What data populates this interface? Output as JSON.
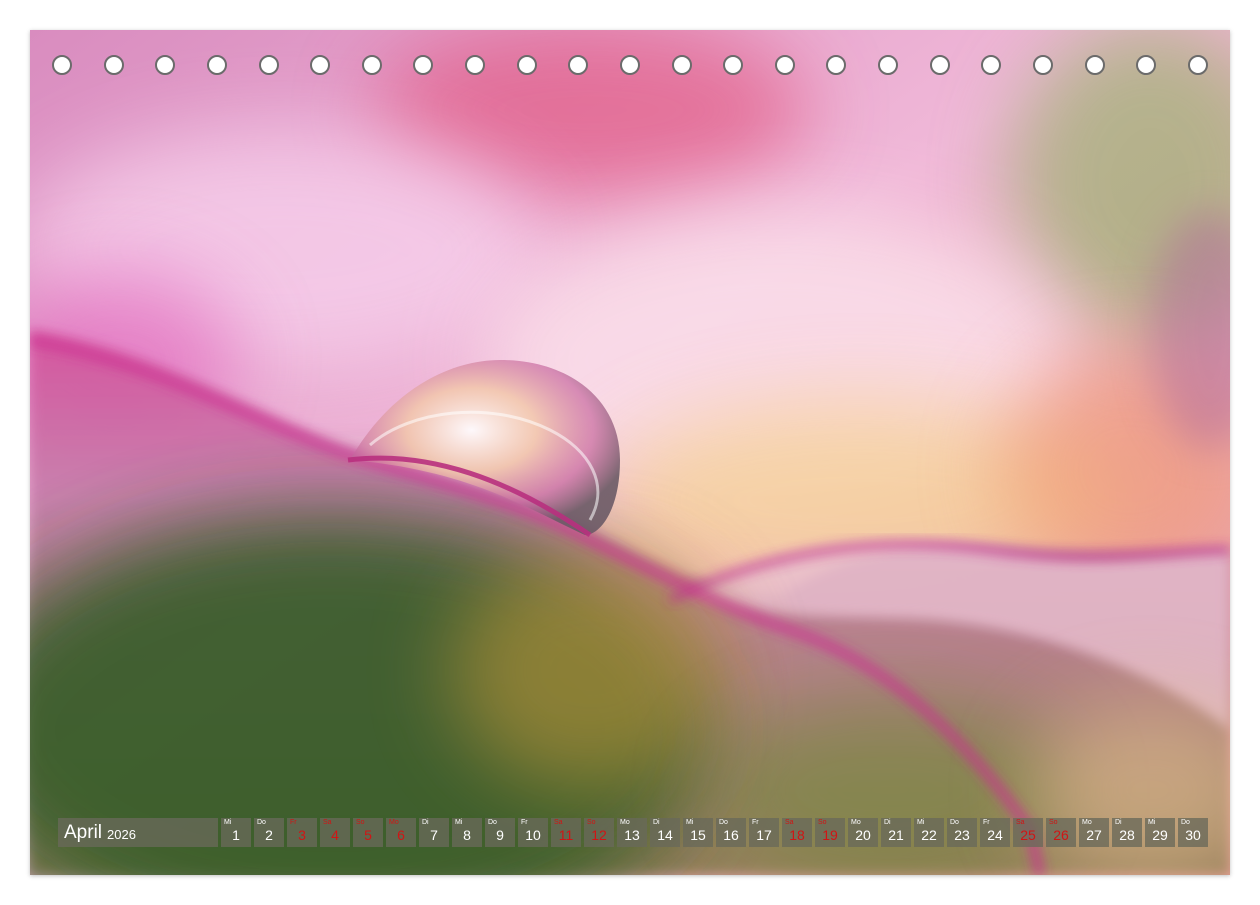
{
  "calendar": {
    "month": "April",
    "year": "2026",
    "days": [
      {
        "wd": "Mi",
        "num": "1",
        "weekend": false
      },
      {
        "wd": "Do",
        "num": "2",
        "weekend": false
      },
      {
        "wd": "Fr",
        "num": "3",
        "weekend": true
      },
      {
        "wd": "Sa",
        "num": "4",
        "weekend": true
      },
      {
        "wd": "So",
        "num": "5",
        "weekend": true
      },
      {
        "wd": "Mo",
        "num": "6",
        "weekend": true
      },
      {
        "wd": "Di",
        "num": "7",
        "weekend": false
      },
      {
        "wd": "Mi",
        "num": "8",
        "weekend": false
      },
      {
        "wd": "Do",
        "num": "9",
        "weekend": false
      },
      {
        "wd": "Fr",
        "num": "10",
        "weekend": false
      },
      {
        "wd": "Sa",
        "num": "11",
        "weekend": true
      },
      {
        "wd": "So",
        "num": "12",
        "weekend": true
      },
      {
        "wd": "Mo",
        "num": "13",
        "weekend": false
      },
      {
        "wd": "Di",
        "num": "14",
        "weekend": false
      },
      {
        "wd": "Mi",
        "num": "15",
        "weekend": false
      },
      {
        "wd": "Do",
        "num": "16",
        "weekend": false
      },
      {
        "wd": "Fr",
        "num": "17",
        "weekend": false
      },
      {
        "wd": "Sa",
        "num": "18",
        "weekend": true
      },
      {
        "wd": "So",
        "num": "19",
        "weekend": true
      },
      {
        "wd": "Mo",
        "num": "20",
        "weekend": false
      },
      {
        "wd": "Di",
        "num": "21",
        "weekend": false
      },
      {
        "wd": "Mi",
        "num": "22",
        "weekend": false
      },
      {
        "wd": "Do",
        "num": "23",
        "weekend": false
      },
      {
        "wd": "Fr",
        "num": "24",
        "weekend": false
      },
      {
        "wd": "Sa",
        "num": "25",
        "weekend": true
      },
      {
        "wd": "So",
        "num": "26",
        "weekend": true
      },
      {
        "wd": "Mo",
        "num": "27",
        "weekend": false
      },
      {
        "wd": "Di",
        "num": "28",
        "weekend": false
      },
      {
        "wd": "Mi",
        "num": "29",
        "weekend": false
      },
      {
        "wd": "Do",
        "num": "30",
        "weekend": false
      }
    ]
  },
  "colors": {
    "weekend_text": "#d01515",
    "day_text": "#ffffff",
    "cell_background": "#69695a",
    "petal_pink": "#d0408f",
    "background_green": "#3f6a2a"
  },
  "binding_holes_count": 23,
  "icons": [
    "binding-hole-icon",
    "water-drop-icon"
  ]
}
